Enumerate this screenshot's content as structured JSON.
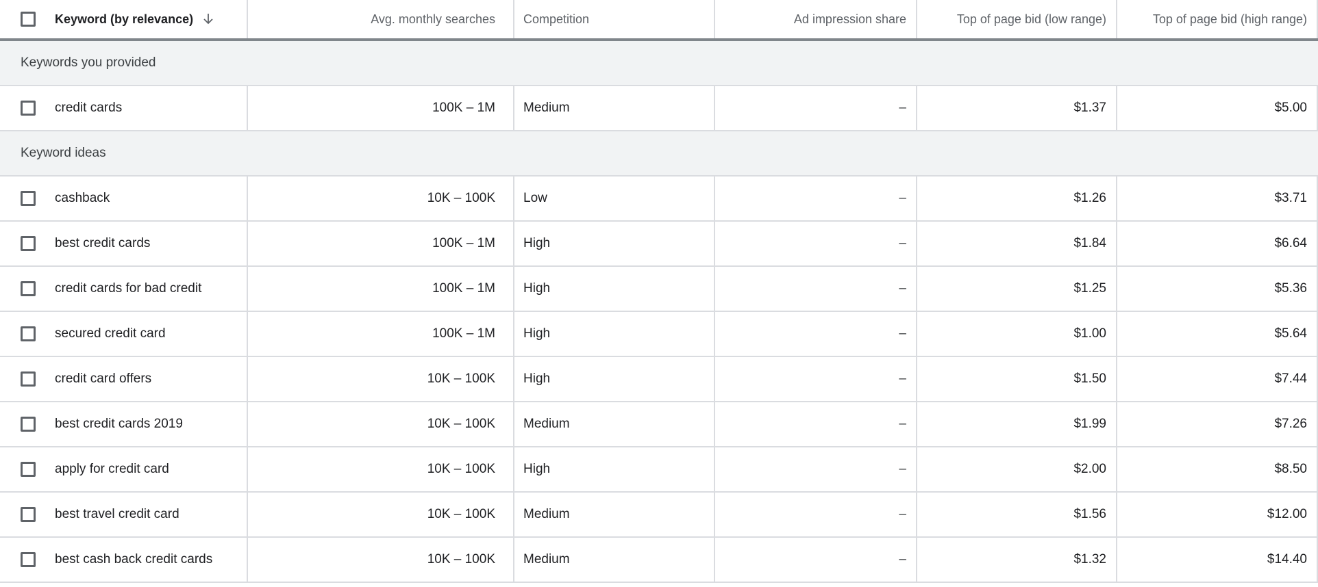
{
  "header": {
    "keyword": "Keyword (by relevance)",
    "avg_searches": "Avg. monthly searches",
    "competition": "Competition",
    "impression_share": "Ad impression share",
    "bid_low": "Top of page bid (low range)",
    "bid_high": "Top of page bid (high range)",
    "sort_icon": "arrow-down-icon"
  },
  "sections": {
    "provided": "Keywords you provided",
    "ideas": "Keyword ideas"
  },
  "provided": [
    {
      "keyword": "credit cards",
      "avg": "100K – 1M",
      "competition": "Medium",
      "impression": "–",
      "low": "$1.37",
      "high": "$5.00"
    }
  ],
  "ideas": [
    {
      "keyword": "cashback",
      "avg": "10K – 100K",
      "competition": "Low",
      "impression": "–",
      "low": "$1.26",
      "high": "$3.71"
    },
    {
      "keyword": "best credit cards",
      "avg": "100K – 1M",
      "competition": "High",
      "impression": "–",
      "low": "$1.84",
      "high": "$6.64"
    },
    {
      "keyword": "credit cards for bad credit",
      "avg": "100K – 1M",
      "competition": "High",
      "impression": "–",
      "low": "$1.25",
      "high": "$5.36"
    },
    {
      "keyword": "secured credit card",
      "avg": "100K – 1M",
      "competition": "High",
      "impression": "–",
      "low": "$1.00",
      "high": "$5.64"
    },
    {
      "keyword": "credit card offers",
      "avg": "10K – 100K",
      "competition": "High",
      "impression": "–",
      "low": "$1.50",
      "high": "$7.44"
    },
    {
      "keyword": "best credit cards 2019",
      "avg": "10K – 100K",
      "competition": "Medium",
      "impression": "–",
      "low": "$1.99",
      "high": "$7.26"
    },
    {
      "keyword": "apply for credit card",
      "avg": "10K – 100K",
      "competition": "High",
      "impression": "–",
      "low": "$2.00",
      "high": "$8.50"
    },
    {
      "keyword": "best travel credit card",
      "avg": "10K – 100K",
      "competition": "Medium",
      "impression": "–",
      "low": "$1.56",
      "high": "$12.00"
    },
    {
      "keyword": "best cash back credit cards",
      "avg": "10K – 100K",
      "competition": "Medium",
      "impression": "–",
      "low": "$1.32",
      "high": "$14.40"
    }
  ]
}
